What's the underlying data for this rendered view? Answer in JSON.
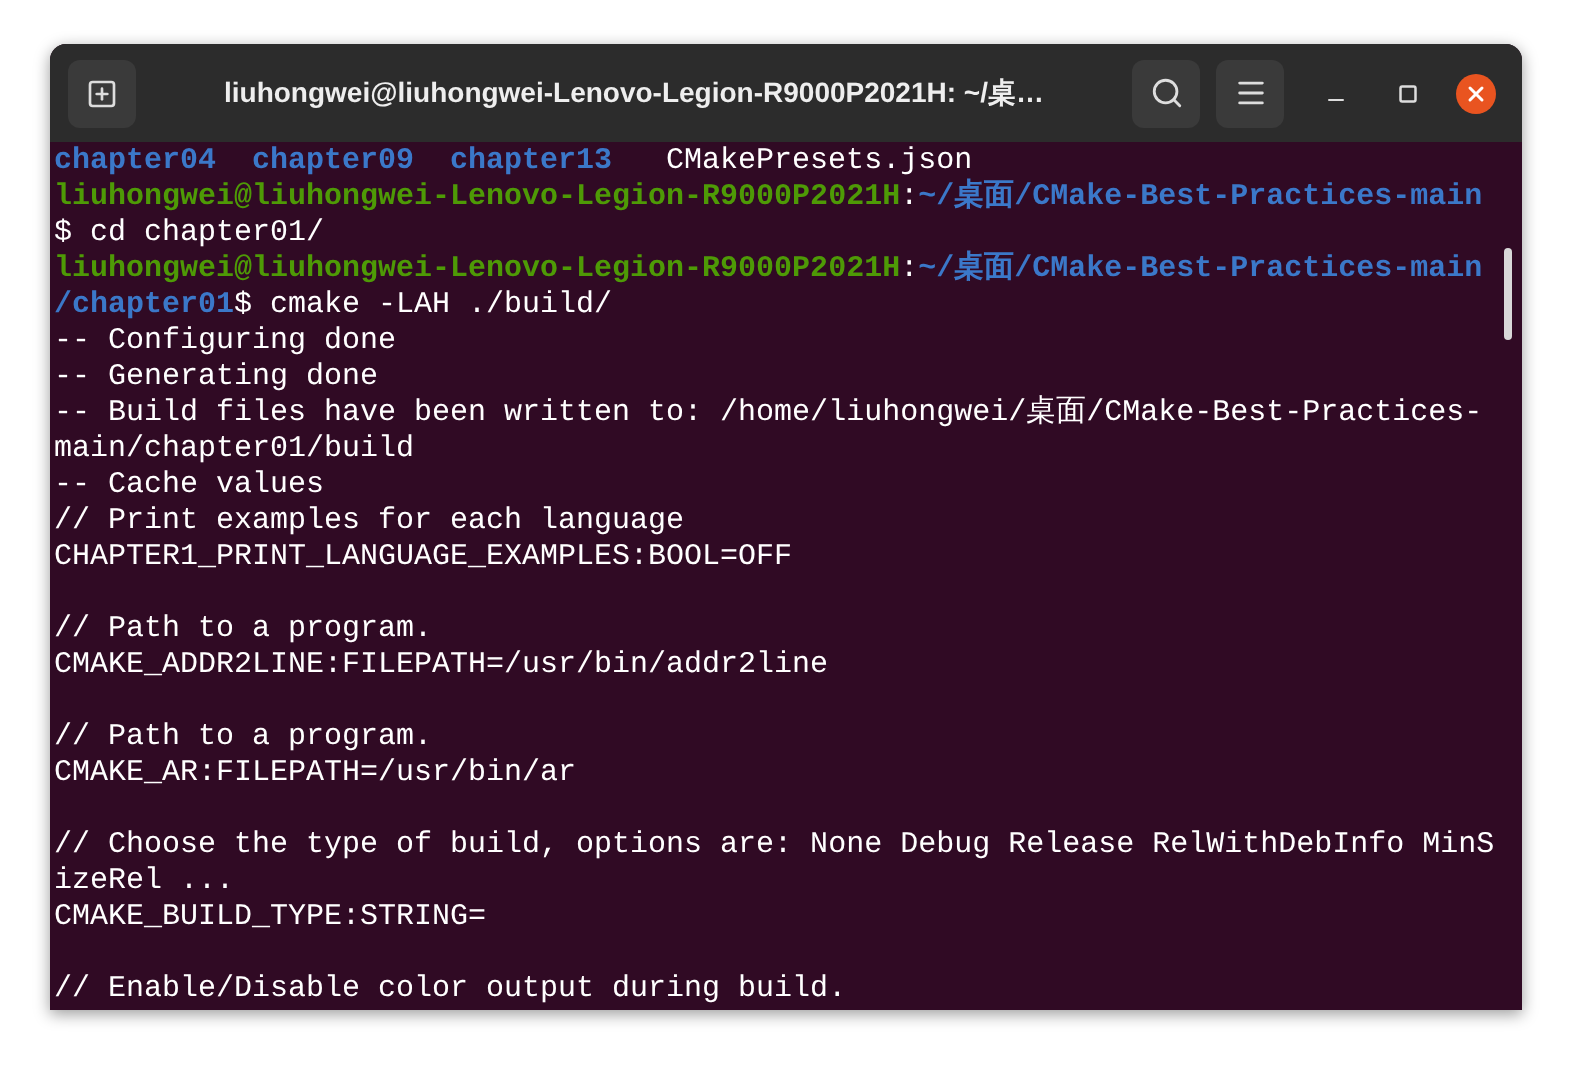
{
  "window": {
    "title": "liuhongwei@liuhongwei-Lenovo-Legion-R9000P2021H: ~/桌…"
  },
  "terminal": {
    "lines": [
      {
        "kind": "text",
        "segments": [
          {
            "kind": "dir",
            "text": "chapter04"
          },
          {
            "kind": "dir",
            "text": "chapter09"
          },
          {
            "kind": "dir",
            "text": "chapter13"
          },
          {
            "kind": "file",
            "text": "CMakePresets.json"
          }
        ]
      },
      {
        "kind": "text",
        "segments": [
          {
            "kind": "user",
            "text": "liuhongwei@liuhongwei-Lenovo-Legion-R9000P2021H"
          },
          {
            "kind": "plain",
            "text": ":"
          },
          {
            "kind": "path",
            "text": "~/桌面/CMake-Best-Practices-main"
          }
        ]
      },
      {
        "kind": "text",
        "segments": [
          {
            "kind": "plain",
            "text": "$ cd chapter01/"
          }
        ]
      },
      {
        "kind": "text",
        "segments": [
          {
            "kind": "user",
            "text": "liuhongwei@liuhongwei-Lenovo-Legion-R9000P2021H"
          },
          {
            "kind": "plain",
            "text": ":"
          },
          {
            "kind": "path",
            "text": "~/桌面/CMake-Best-Practices-main"
          }
        ]
      },
      {
        "kind": "text",
        "segments": [
          {
            "kind": "path",
            "text": "/chapter01"
          },
          {
            "kind": "plain",
            "text": "$ cmake -LAH ./build/"
          }
        ]
      },
      {
        "kind": "text",
        "segments": [
          {
            "kind": "plain",
            "text": "-- Configuring done"
          }
        ]
      },
      {
        "kind": "text",
        "segments": [
          {
            "kind": "plain",
            "text": "-- Generating done"
          }
        ]
      },
      {
        "kind": "text",
        "segments": [
          {
            "kind": "plain",
            "text": "-- Build files have been written to: /home/liuhongwei/桌面/CMake-Best-Practices-"
          }
        ]
      },
      {
        "kind": "text",
        "segments": [
          {
            "kind": "plain",
            "text": "main/chapter01/build"
          }
        ]
      },
      {
        "kind": "text",
        "segments": [
          {
            "kind": "plain",
            "text": "-- Cache values"
          }
        ]
      },
      {
        "kind": "text",
        "segments": [
          {
            "kind": "plain",
            "text": "// Print examples for each language"
          }
        ]
      },
      {
        "kind": "text",
        "segments": [
          {
            "kind": "plain",
            "text": "CHAPTER1_PRINT_LANGUAGE_EXAMPLES:BOOL=OFF"
          }
        ]
      },
      {
        "kind": "blank"
      },
      {
        "kind": "text",
        "segments": [
          {
            "kind": "plain",
            "text": "// Path to a program."
          }
        ]
      },
      {
        "kind": "text",
        "segments": [
          {
            "kind": "plain",
            "text": "CMAKE_ADDR2LINE:FILEPATH=/usr/bin/addr2line"
          }
        ]
      },
      {
        "kind": "blank"
      },
      {
        "kind": "text",
        "segments": [
          {
            "kind": "plain",
            "text": "// Path to a program."
          }
        ]
      },
      {
        "kind": "text",
        "segments": [
          {
            "kind": "plain",
            "text": "CMAKE_AR:FILEPATH=/usr/bin/ar"
          }
        ]
      },
      {
        "kind": "blank"
      },
      {
        "kind": "text",
        "segments": [
          {
            "kind": "plain",
            "text": "// Choose the type of build, options are: None Debug Release RelWithDebInfo MinS"
          }
        ]
      },
      {
        "kind": "text",
        "segments": [
          {
            "kind": "plain",
            "text": "izeRel ..."
          }
        ]
      },
      {
        "kind": "text",
        "segments": [
          {
            "kind": "plain",
            "text": "CMAKE_BUILD_TYPE:STRING="
          }
        ]
      },
      {
        "kind": "blank"
      },
      {
        "kind": "text",
        "segments": [
          {
            "kind": "plain",
            "text": "// Enable/Disable color output during build."
          }
        ]
      }
    ]
  }
}
